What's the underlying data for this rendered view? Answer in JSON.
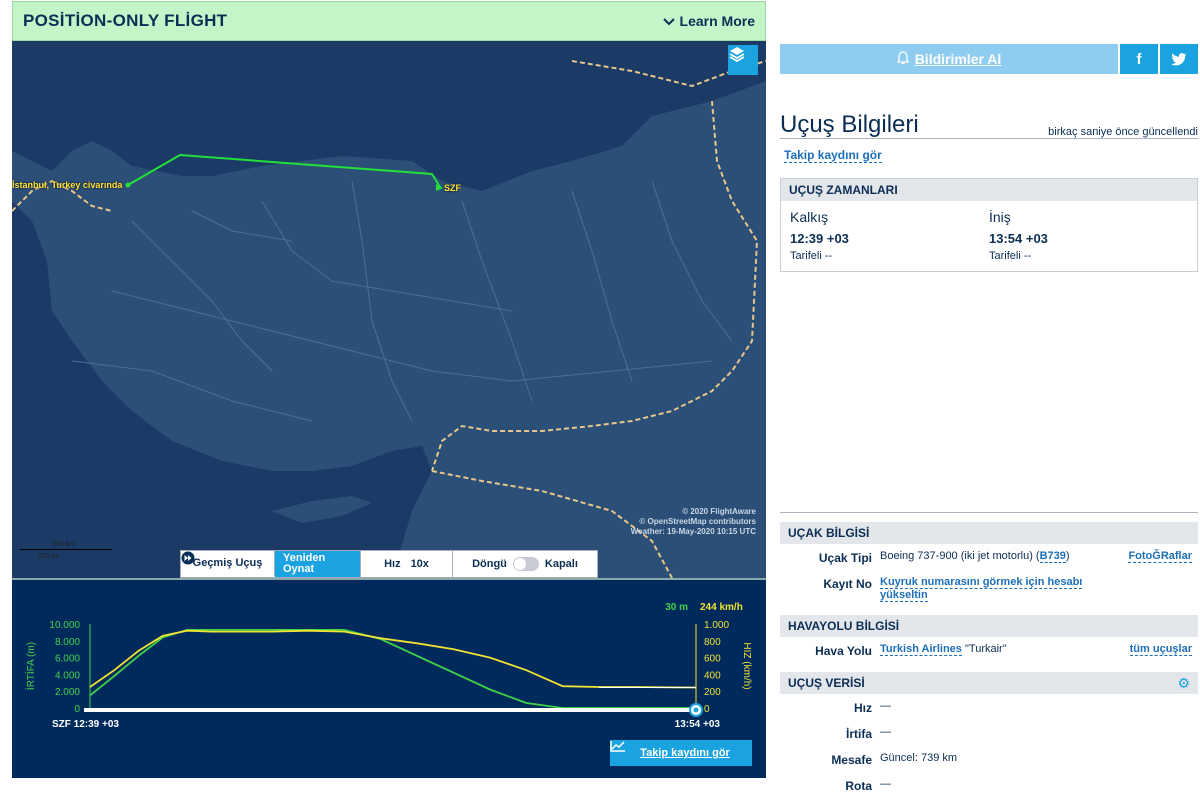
{
  "header": {
    "title": "POSİTİON-ONLY FLİGHT",
    "learn_more": "Learn More"
  },
  "map": {
    "origin_label": "İstanbul, Turkey civarında",
    "dest_label": "SZF",
    "attribution": [
      "© 2020 FlightAware",
      "© OpenStreetMap contributors",
      "Weather: 19-May-2020 10:15 UTC"
    ],
    "scale_top": "200 km",
    "scale_bottom": "100 mi",
    "colors": {
      "route": "#22e03a",
      "land": "#2c4f77",
      "sea": "#1b3a66",
      "border": "#e8c58a"
    }
  },
  "controls": {
    "past_flight": "Geçmiş Uçuş",
    "replay": "Yeniden Oynat",
    "speed_label": "Hız",
    "speed_value": "10x",
    "loop_label": "Döngü",
    "loop_state": "Kapalı"
  },
  "chart_data": {
    "type": "line",
    "x_start_label": "SZF 12:39 +03",
    "x_end_label": "13:54 +03",
    "left_axis": {
      "label": "İRTİFA (m)",
      "ticks": [
        "10.000",
        "8.000",
        "6.000",
        "4.000",
        "2.000",
        "0"
      ],
      "ylim": [
        0,
        10000
      ],
      "current": "30 m"
    },
    "right_axis": {
      "label": "HIZ (km/h)",
      "ticks": [
        "1.000",
        "800",
        "600",
        "400",
        "200",
        "0"
      ],
      "ylim": [
        0,
        1000
      ],
      "current": "244 km/h"
    },
    "x": [
      0,
      4,
      8,
      12,
      16,
      20,
      24,
      30,
      36,
      42,
      48,
      54,
      60,
      66,
      72,
      78,
      84,
      90,
      96,
      100
    ],
    "series": [
      {
        "values": [
          1500,
          3800,
          6200,
          8400,
          9300,
          9300,
          9300,
          9300,
          9300,
          9300,
          8200,
          6200,
          4200,
          2200,
          600,
          0,
          0,
          0,
          0,
          0
        ]
      },
      {
        "values": [
          250,
          450,
          680,
          860,
          920,
          910,
          910,
          910,
          920,
          910,
          830,
          770,
          700,
          600,
          450,
          260,
          250,
          250,
          245,
          244
        ]
      }
    ],
    "colors": {
      "altitude": "#3fd34a",
      "speed": "#f2e233",
      "text_alt": "#3fd34a",
      "text_spd": "#f2e233"
    },
    "track_button": "Takip kaydını gör"
  },
  "right": {
    "notify": "Bildirimler Al",
    "facebook": "f",
    "twitter": "t",
    "info_title": "Uçuş Bilgileri",
    "updated": "birkaç saniye önce güncellendi",
    "track_link": "Takip kaydını gör",
    "times": {
      "section": "UÇUŞ ZAMANLARI",
      "dep_label": "Kalkış",
      "dep_time": "12:39 +03",
      "dep_sched": "Tarifeli --",
      "arr_label": "İniş",
      "arr_time": "13:54 +03",
      "arr_sched": "Tarifeli --"
    },
    "aircraft": {
      "section": "UÇAK BİLGİSİ",
      "type_k": "Uçak Tipi",
      "type_v": "Boeing 737-900 (iki jet motorlu) (",
      "type_code": "B739",
      "type_end": ")",
      "photos": "FotoĞRaflar",
      "reg_k": "Kayıt No",
      "reg_v": "Kuyruk numarasını görmek için hesabı yükseltin"
    },
    "airline": {
      "section": "HAVAYOLU BİLGİSİ",
      "k": "Hava Yolu",
      "name": "Turkish Airlines",
      "call": "\"Turkair\"",
      "all": "tüm uçuşlar"
    },
    "data": {
      "section": "UÇUŞ VERİSİ",
      "speed_k": "Hız",
      "speed_v": "—",
      "alt_k": "İrtifa",
      "alt_v": "—",
      "dist_k": "Mesafe",
      "dist_v": "Güncel: 739 km",
      "route_k": "Rota",
      "route_v": "—"
    }
  }
}
